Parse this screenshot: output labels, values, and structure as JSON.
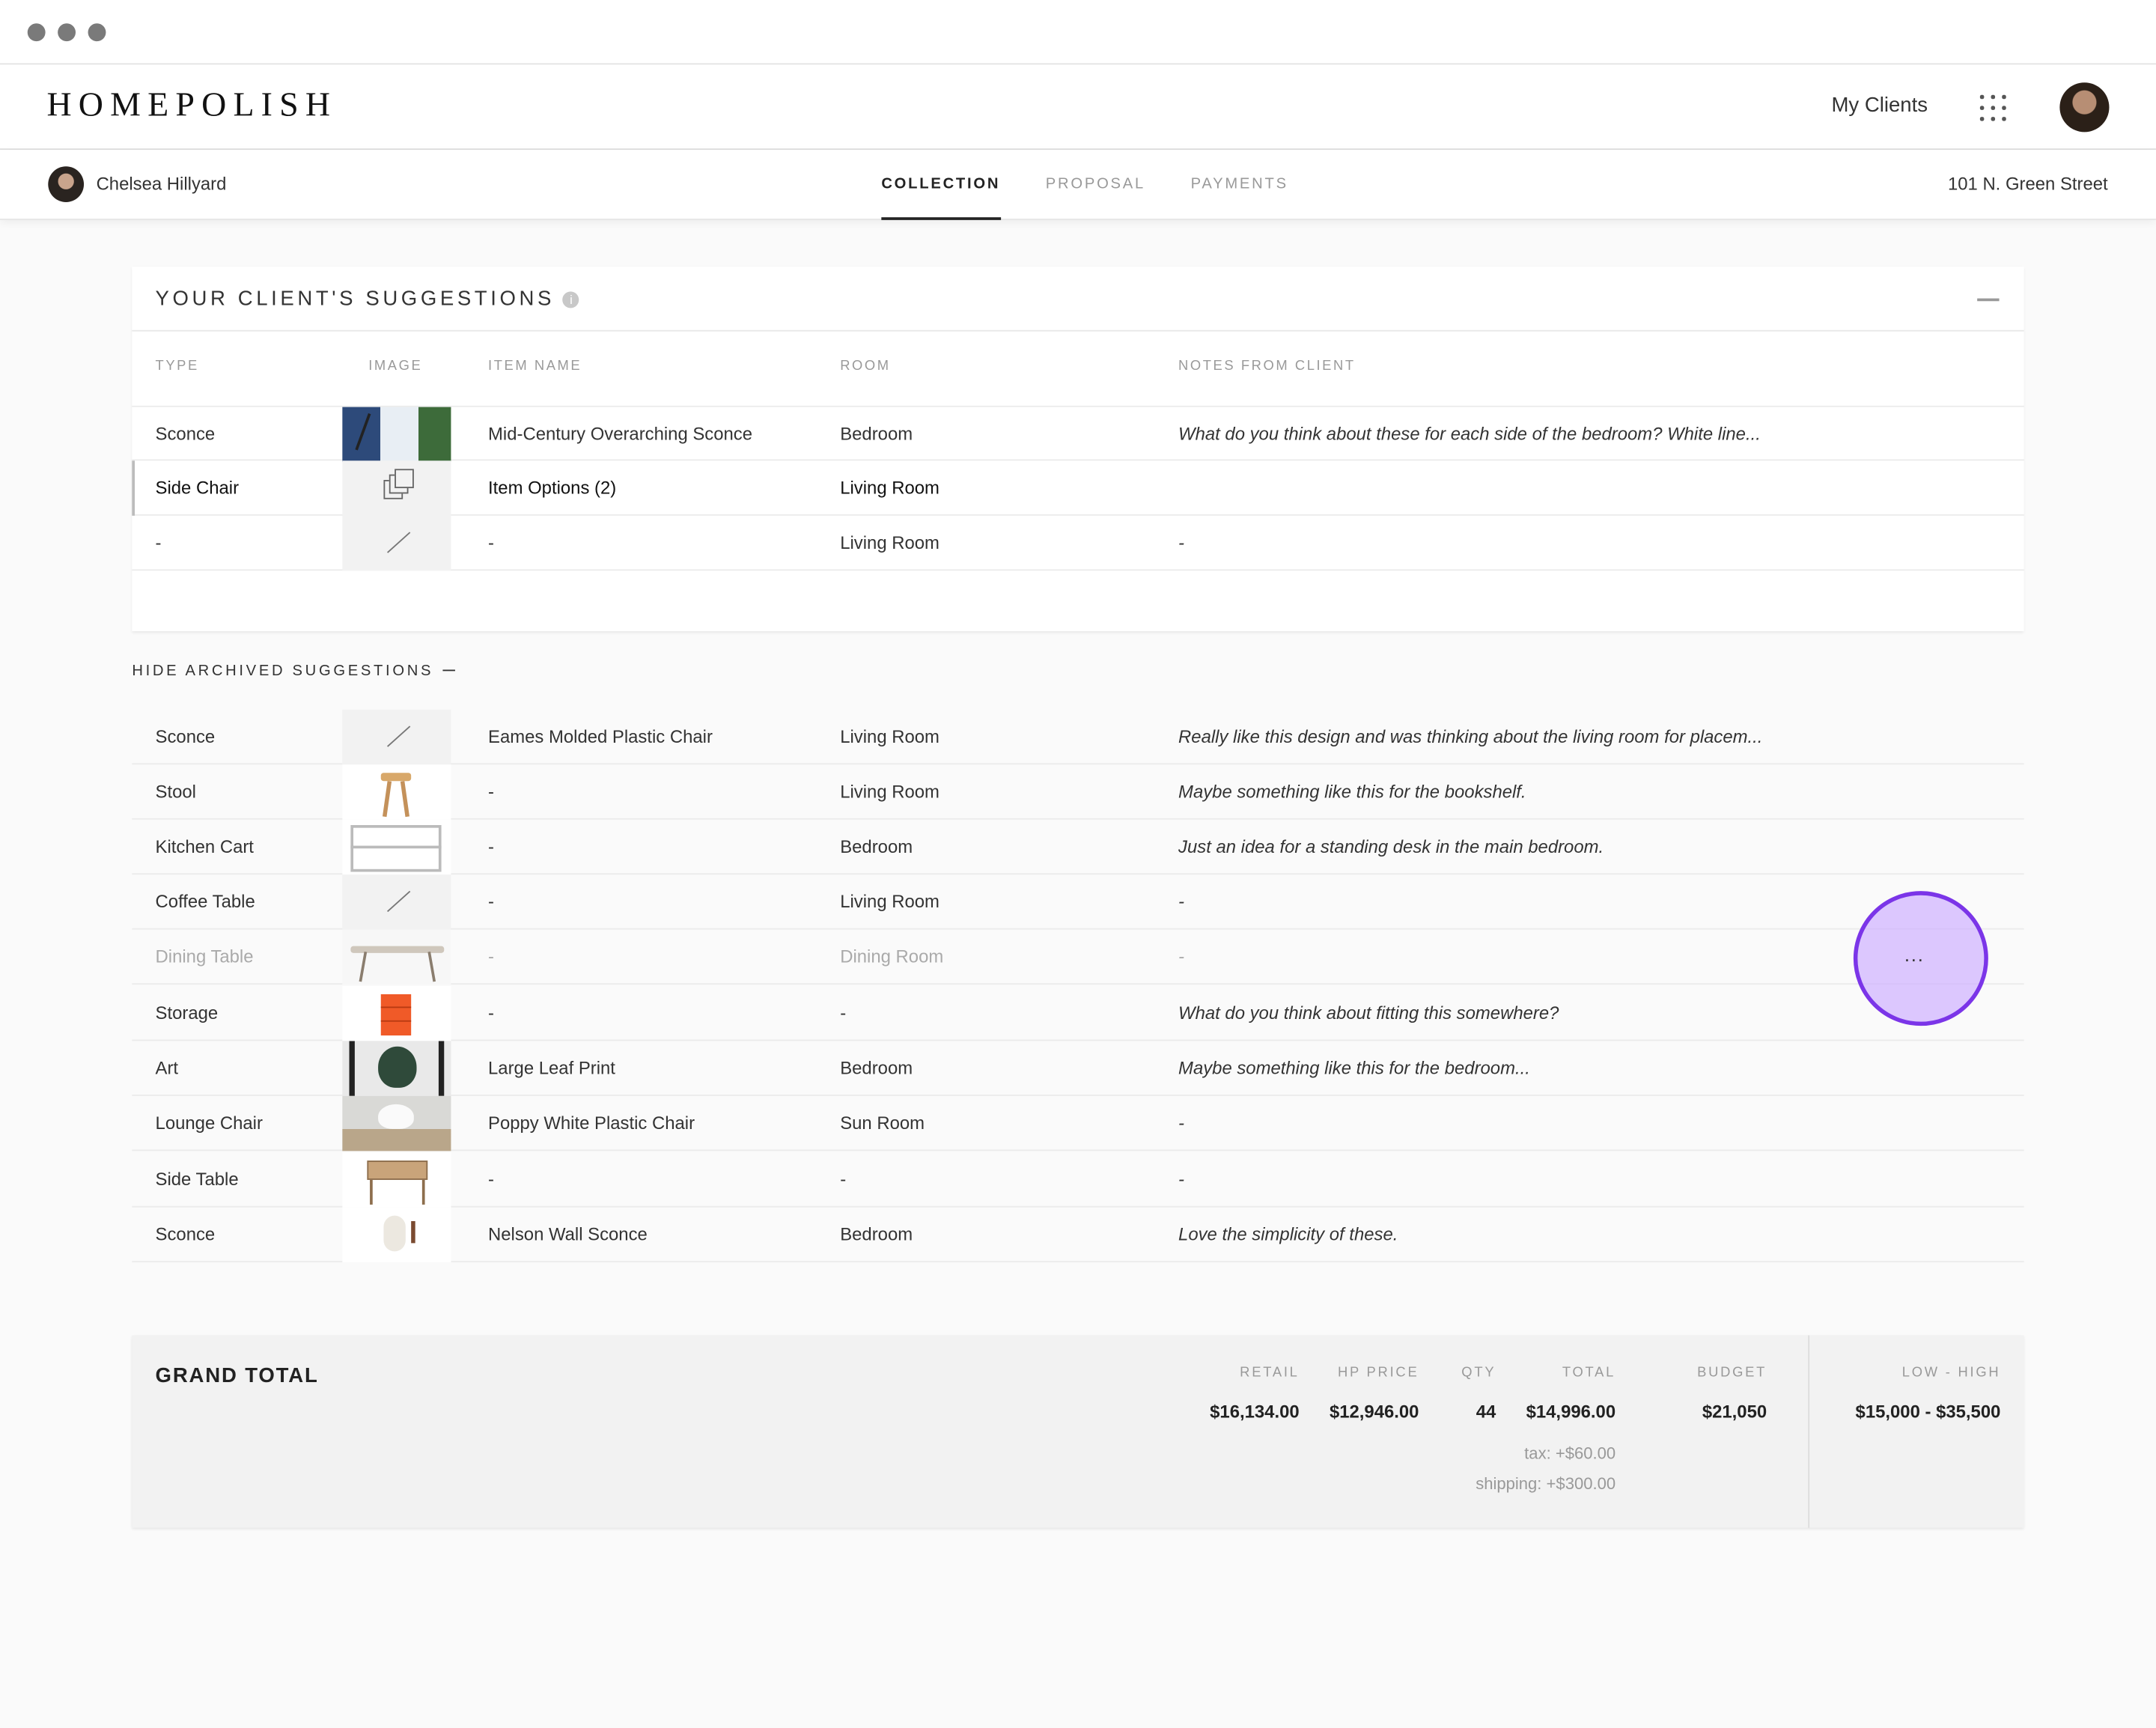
{
  "header": {
    "logo": "HOMEPOLISH",
    "my_clients": "My Clients"
  },
  "subnav": {
    "client_name": "Chelsea Hillyard",
    "tabs": [
      "COLLECTION",
      "PROPOSAL",
      "PAYMENTS"
    ],
    "active_tab": "COLLECTION",
    "address": "101 N. Green Street"
  },
  "suggestions": {
    "title": "YOUR CLIENT'S SUGGESTIONS",
    "info_icon": "i",
    "columns": [
      "TYPE",
      "IMAGE",
      "ITEM NAME",
      "ROOM",
      "NOTES FROM CLIENT"
    ],
    "rows": [
      {
        "type": "Sconce",
        "image": "sconce-photo",
        "name": "Mid-Century Overarching Sconce",
        "room": "Bedroom",
        "notes": "What do you think about these for each side of the bedroom? White line..."
      },
      {
        "type": "Side Chair",
        "image": "item-options-icon",
        "name": "Item Options (2)",
        "room": "Living Room",
        "notes": ""
      },
      {
        "type": "-",
        "image": "no-image",
        "name": "-",
        "room": "Living Room",
        "notes": "-"
      }
    ]
  },
  "archived": {
    "toggle_label": "HIDE ARCHIVED SUGGESTIONS",
    "rows": [
      {
        "type": "Sconce",
        "image": "no-image",
        "name": "Eames Molded Plastic Chair",
        "room": "Living Room",
        "notes": "Really like this design and was thinking about the living room for placem..."
      },
      {
        "type": "Stool",
        "image": "stool-photo",
        "name": "-",
        "room": "Living Room",
        "notes": "Maybe something like this for the bookshelf."
      },
      {
        "type": "Kitchen Cart",
        "image": "cart-photo",
        "name": "-",
        "room": "Bedroom",
        "notes": "Just an idea for a standing desk in the main bedroom."
      },
      {
        "type": "Coffee Table",
        "image": "no-image",
        "name": "-",
        "room": "Living Room",
        "notes": "-"
      },
      {
        "type": "Dining Table",
        "image": "table-photo",
        "name": "-",
        "room": "Dining Room",
        "notes": "-"
      },
      {
        "type": "Storage",
        "image": "storage-photo",
        "name": "-",
        "room": "-",
        "notes": "What do you think about fitting this somewhere?"
      },
      {
        "type": "Art",
        "image": "leaf-print-photo",
        "name": "Large Leaf Print",
        "room": "Bedroom",
        "notes": "Maybe something like this for the bedroom..."
      },
      {
        "type": "Lounge Chair",
        "image": "chair-photo",
        "name": "Poppy White Plastic Chair",
        "room": "Sun Room",
        "notes": "-"
      },
      {
        "type": "Side Table",
        "image": "side-table-photo",
        "name": "-",
        "room": "-",
        "notes": "-"
      },
      {
        "type": "Sconce",
        "image": "wall-sconce-photo",
        "name": "Nelson Wall Sconce",
        "room": "Bedroom",
        "notes": "Love the simplicity of these."
      }
    ]
  },
  "grand_total": {
    "title": "GRAND TOTAL",
    "headers": {
      "retail": "RETAIL",
      "hp_price": "HP PRICE",
      "qty": "QTY",
      "total": "TOTAL",
      "budget": "BUDGET",
      "low_high": "LOW - HIGH"
    },
    "values": {
      "retail": "$16,134.00",
      "hp_price": "$12,946.00",
      "qty": "44",
      "total": "$14,996.00",
      "budget": "$21,050",
      "low_high": "$15,000 - $35,500"
    },
    "tax": "tax:  +$60.00",
    "shipping": "shipping:  +$300.00"
  },
  "row_action": {
    "label": "..."
  },
  "colors": {
    "accent": "#7b35e8",
    "cursor_fill": "#ceb0ff",
    "storage_orange": "#f05a28"
  }
}
